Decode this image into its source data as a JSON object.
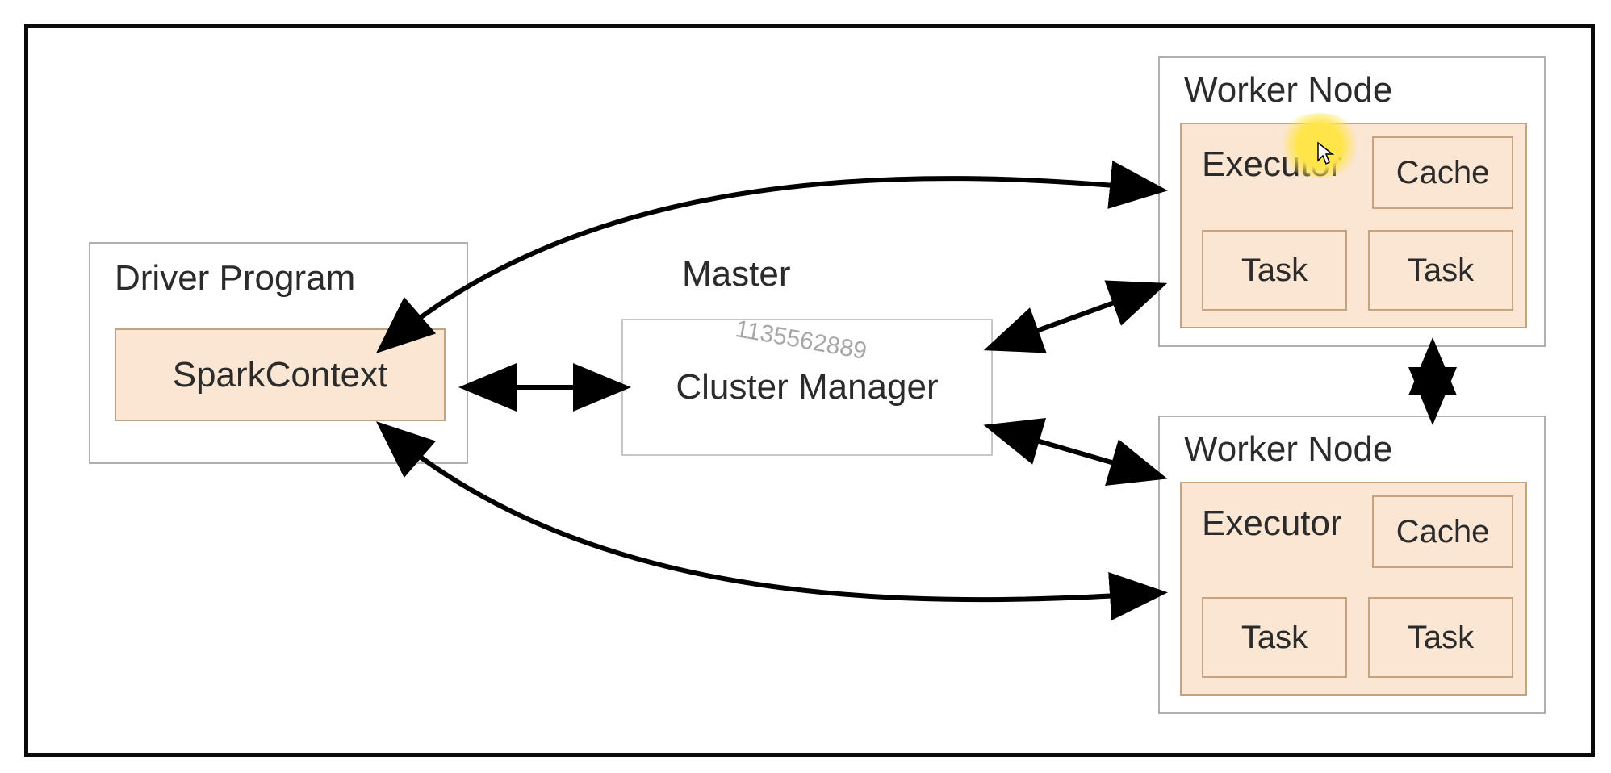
{
  "driver": {
    "title": "Driver Program",
    "sparkcontext": "SparkContext"
  },
  "master": {
    "title": "Master",
    "cluster_manager": "Cluster Manager"
  },
  "worker1": {
    "title": "Worker Node",
    "executor": "Executor",
    "cache": "Cache",
    "task1": "Task",
    "task2": "Task"
  },
  "worker2": {
    "title": "Worker Node",
    "executor": "Executor",
    "cache": "Cache",
    "task1": "Task",
    "task2": "Task"
  },
  "watermark": "1135562889"
}
